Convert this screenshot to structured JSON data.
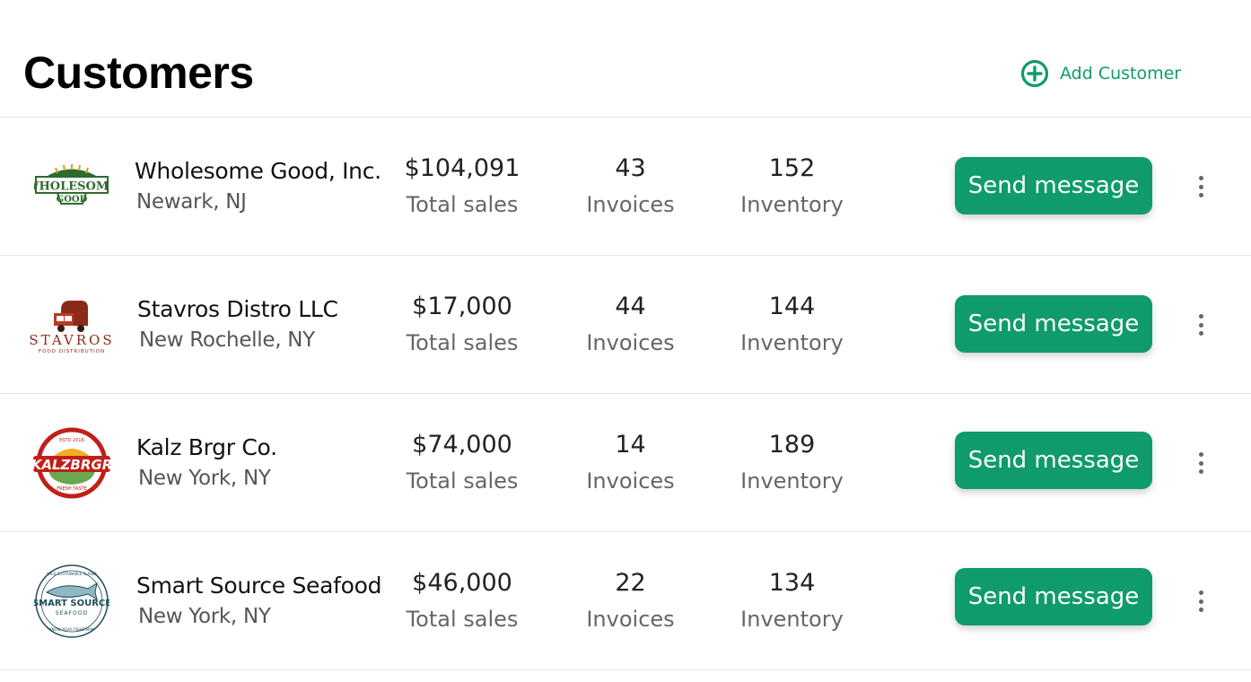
{
  "page": {
    "title": "Customers",
    "add_customer_label": "Add Customer"
  },
  "accent_color": "#0f9b6c",
  "stat_captions": {
    "sales": "Total sales",
    "invoices": "Invoices",
    "inventory": "Inventory"
  },
  "send_button_label": "Send message",
  "customers": [
    {
      "name": "Wholesome Good, Inc.",
      "location": "Newark, NJ",
      "total_sales": "$104,091",
      "invoices": "43",
      "inventory": "152",
      "logo": {
        "icon": "wholesome-good-logo",
        "line1": "WHOLESOME",
        "line2": "GOOD"
      }
    },
    {
      "name": "Stavros Distro LLC",
      "location": "New Rochelle, NY",
      "total_sales": "$17,000",
      "invoices": "44",
      "inventory": "144",
      "logo": {
        "icon": "stavros-logo",
        "line1": "STAVROS",
        "line2": "FOOD DISTRIBUTION"
      }
    },
    {
      "name": "Kalz Brgr Co.",
      "location": "New York, NY",
      "total_sales": "$74,000",
      "invoices": "14",
      "inventory": "189",
      "logo": {
        "icon": "kalz-brgr-logo",
        "line1": "KALZBRGR",
        "top": "ESTD 2016",
        "bottom": "FRESH TASTE"
      }
    },
    {
      "name": "Smart Source Seafood",
      "location": "New York, NY",
      "total_sales": "$46,000",
      "invoices": "22",
      "inventory": "134",
      "logo": {
        "icon": "smart-source-logo",
        "line1": "SMART SOURCE",
        "line2": "SEAFOOD",
        "ring_top": "WILD SUSTAINABLE ALASKA",
        "ring_bottom": "KNOW YOUR FISHERMAN"
      }
    }
  ]
}
